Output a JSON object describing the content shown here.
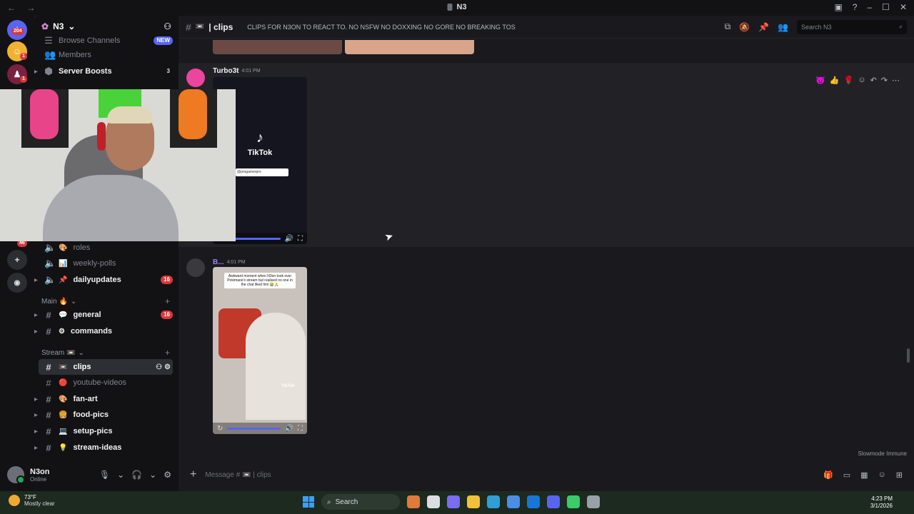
{
  "window": {
    "title": "N3",
    "nav": "← →",
    "controls": [
      "▣",
      "?",
      "–",
      "☐",
      "✕"
    ]
  },
  "rail": {
    "badge_top": "204",
    "badge_mid": "1",
    "badge_low": "1",
    "badge_under": "46"
  },
  "server": {
    "name": "N3"
  },
  "sidebar": {
    "browse": "Browse Channels",
    "browse_badge": "NEW",
    "members": "Members",
    "boosts": "Server Boosts",
    "boosts_count": "3",
    "channels_top": [
      {
        "label": "roles",
        "emoji": "🎨"
      },
      {
        "label": "weekly-polls",
        "emoji": "📊"
      },
      {
        "label": "dailyupdates",
        "emoji": "📌",
        "count": "16"
      }
    ],
    "cat_main": "Main 🔥",
    "channels_main": [
      {
        "label": "general",
        "emoji": "💬",
        "count": "16"
      },
      {
        "label": "commands",
        "emoji": "⚙"
      }
    ],
    "cat_stream": "Stream 📼",
    "channels_stream": [
      {
        "label": "clips",
        "emoji": "📼"
      },
      {
        "label": "youtube-videos",
        "emoji": "🔴"
      },
      {
        "label": "fan-art",
        "emoji": "🎨"
      },
      {
        "label": "food-pics",
        "emoji": "🍔"
      },
      {
        "label": "setup-pics",
        "emoji": "💻"
      },
      {
        "label": "stream-ideas",
        "emoji": "💡"
      }
    ]
  },
  "user": {
    "name": "N3on",
    "status": "Online"
  },
  "channel": {
    "name": "| clips",
    "topic": "CLIPS FOR N3ON TO REACT TO. NO NSFW NO DOXXING NO GORE NO BREAKING TOS",
    "search_placeholder": "Search N3"
  },
  "messages": [
    {
      "author": "Turbo3t",
      "time": "4:01 PM",
      "video_brand": "TikTok",
      "video_handle": "@progamerpro"
    },
    {
      "author": "B...",
      "time": "4:01 PM",
      "video_caption": "Awkward moment when N3on took over Pokimane's stream but realised no one in the chat liked him 😭🙏",
      "video_brand": "TikTok"
    }
  ],
  "composer": {
    "placeholder": "Message # 📼 | clips"
  },
  "slowmode": "Slowmode Immune",
  "taskbar": {
    "temp": "73°F",
    "weather": "Mostly clear",
    "search": "Search",
    "time": "4:23 PM",
    "date": "3/1/2026"
  },
  "colors": {
    "accent": "#5865f2",
    "badge": "#da373c",
    "online": "#23a55a"
  }
}
